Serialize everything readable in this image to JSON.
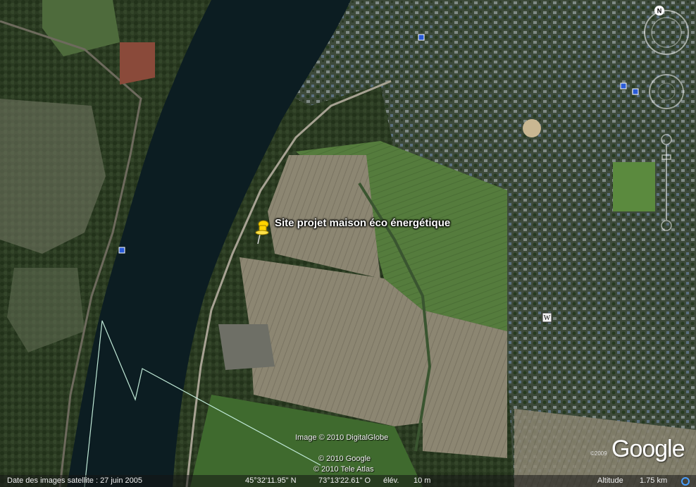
{
  "app": "Google Earth",
  "placemark": {
    "label": "Site projet maison éco énergétique",
    "icon": "pushpin-icon",
    "color": "#ffd400"
  },
  "credits": {
    "imagery": "Image © 2010 DigitalGlobe",
    "google": "© 2010 Google",
    "tele_atlas": "© 2010 Tele Atlas"
  },
  "logo": {
    "text": "Google",
    "year": "©2009"
  },
  "status_bar": {
    "imagery_date": "Date des images satellite : 27 juin 2005",
    "latitude": "45°32'11.95\" N",
    "longitude": "73°13'22.61\" O",
    "elevation_label": "élév.",
    "elevation_value": "10 m",
    "altitude_label": "Altitude",
    "altitude_value": "1.75 km"
  },
  "compass": {
    "north_label": "N"
  },
  "poi_markers": [
    {
      "name": "wikipedia-marker",
      "glyph": "W"
    }
  ],
  "colors": {
    "river": "#0c1d22",
    "field_green": "#4f7a3a",
    "field_plowed": "#8f8a74",
    "boundary_line": "#bfe8d6"
  }
}
